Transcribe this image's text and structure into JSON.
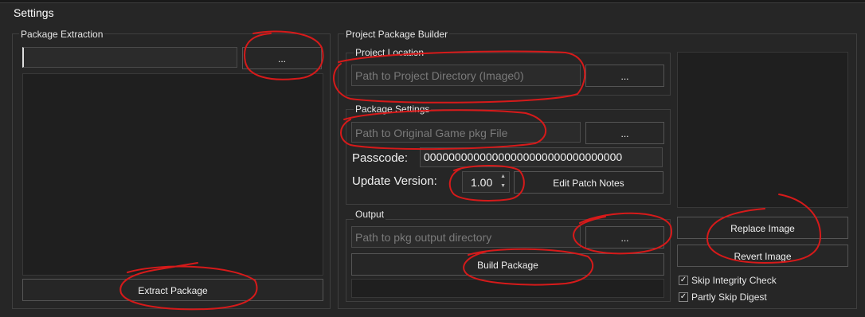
{
  "window": {
    "title": "Settings"
  },
  "package_extraction": {
    "label": "Package Extraction",
    "path_value": "",
    "browse_label": "...",
    "extract_label": "Extract Package"
  },
  "project_builder": {
    "label": "Project Package Builder",
    "project_location": {
      "label": "Project Location",
      "placeholder": "Path to Project Directory (Image0)",
      "browse_label": "..."
    },
    "package_settings": {
      "label": "Package Settings",
      "pkg_placeholder": "Path to Original Game pkg File",
      "browse_label": "...",
      "passcode_label": "Passcode:",
      "passcode_value": "00000000000000000000000000000000",
      "update_version_label": "Update Version:",
      "update_version_value": "1.00",
      "edit_patch_notes_label": "Edit Patch Notes"
    },
    "output": {
      "label": "Output",
      "placeholder": "Path to pkg output directory",
      "browse_label": "...",
      "build_label": "Build Package"
    }
  },
  "image_panel": {
    "replace_label": "Replace Image",
    "revert_label": "Revert Image",
    "skip_integrity_label": "Skip Integrity Check",
    "skip_integrity_checked": true,
    "partly_skip_digest_label": "Partly Skip Digest",
    "partly_skip_digest_checked": true,
    "check_glyph": "✓"
  },
  "colors": {
    "annotation": "#d61a1a",
    "background": "#262626"
  }
}
